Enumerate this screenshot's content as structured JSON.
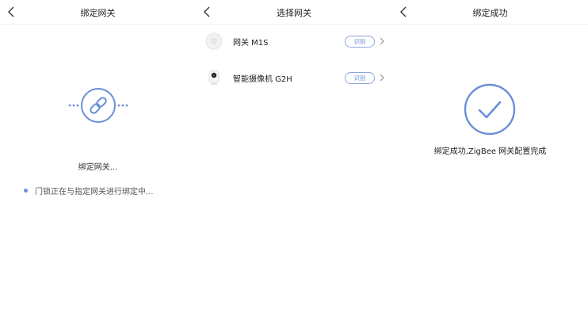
{
  "colors": {
    "accent": "#6a8fd8",
    "text": "#222222",
    "subtext": "#555555"
  },
  "screen1": {
    "title": "绑定网关",
    "back_icon": "chevron-left-icon",
    "link_icon": "link-icon",
    "binding_label": "绑定网关...",
    "status_text": "门锁正在与指定网关进行绑定中..."
  },
  "screen2": {
    "title": "选择网关",
    "back_icon": "chevron-left-icon",
    "devices": [
      {
        "name": "网关 M1S",
        "icon": "gateway-icon",
        "action_label": "识别"
      },
      {
        "name": "智能摄像机 G2H",
        "icon": "camera-icon",
        "action_label": "识别"
      }
    ]
  },
  "screen3": {
    "title": "绑定成功",
    "back_icon": "chevron-left-icon",
    "success_icon": "checkmark-icon",
    "success_text": "绑定成功,ZigBee 网关配置完成"
  }
}
